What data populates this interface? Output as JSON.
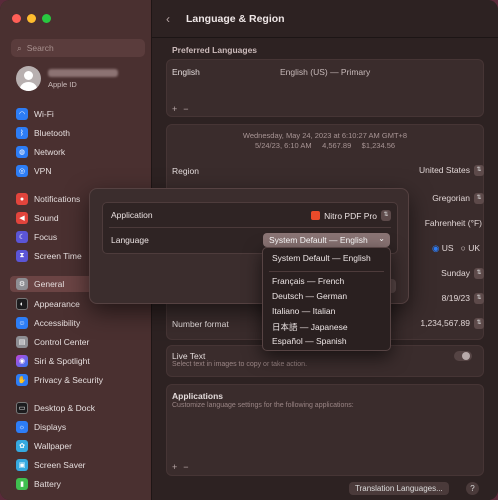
{
  "window": {
    "title": "Language & Region"
  },
  "traffic_lights": {
    "close": "#ff5f57",
    "minimize": "#febc2e",
    "zoom": "#28c840"
  },
  "sidebar": {
    "search_placeholder": "Search",
    "profile_sub": "Apple ID",
    "items": [
      {
        "label": "Wi-Fi",
        "icon": "wifi-icon",
        "color": "#2d7df6"
      },
      {
        "label": "Bluetooth",
        "icon": "bluetooth-icon",
        "color": "#2d7df6"
      },
      {
        "label": "Network",
        "icon": "globe-icon",
        "color": "#2d7df6"
      },
      {
        "label": "VPN",
        "icon": "vpn-icon",
        "color": "#2d7df6"
      },
      {
        "label": "Notifications",
        "icon": "bell-icon",
        "color": "#e2443c"
      },
      {
        "label": "Sound",
        "icon": "speaker-icon",
        "color": "#e2443c"
      },
      {
        "label": "Focus",
        "icon": "moon-icon",
        "color": "#5b55d6"
      },
      {
        "label": "Screen Time",
        "icon": "hourglass-icon",
        "color": "#5b55d6"
      },
      {
        "label": "General",
        "icon": "gear-icon",
        "color": "#8e8e93"
      },
      {
        "label": "Appearance",
        "icon": "appearance-icon",
        "color": "#1c1c1e"
      },
      {
        "label": "Accessibility",
        "icon": "accessibility-icon",
        "color": "#2d7df6"
      },
      {
        "label": "Control Center",
        "icon": "control-center-icon",
        "color": "#8e8e93"
      },
      {
        "label": "Siri & Spotlight",
        "icon": "siri-icon",
        "color": "#c543d8"
      },
      {
        "label": "Privacy & Security",
        "icon": "hand-icon",
        "color": "#2d7df6"
      },
      {
        "label": "Desktop & Dock",
        "icon": "dock-icon",
        "color": "#1c1c1e"
      },
      {
        "label": "Displays",
        "icon": "display-icon",
        "color": "#2d7df6"
      },
      {
        "label": "Wallpaper",
        "icon": "wallpaper-icon",
        "color": "#35a9e0"
      },
      {
        "label": "Screen Saver",
        "icon": "screensaver-icon",
        "color": "#35a9e0"
      },
      {
        "label": "Battery",
        "icon": "battery-icon",
        "color": "#3fbf4f"
      }
    ]
  },
  "main": {
    "preferred_languages_title": "Preferred Languages",
    "pref_lang_name": "English",
    "pref_lang_detail": "English (US) — Primary",
    "preview_line1": "Wednesday, May 24, 2023 at 6:10:27 AM GMT+8",
    "preview_line2": "5/24/23, 6:10 AM     4,567.89     $1,234.56",
    "region_label": "Region",
    "region_value": "United States",
    "calendar_value": "Gregorian",
    "temperature_value": "Fahrenheit (°F)",
    "measurement_us": "US",
    "measurement_uk": "UK",
    "first_day_value": "Sunday",
    "date_format_value": "8/19/23",
    "number_format_label": "Number format",
    "number_format_value": "1,234,567.89",
    "live_text_title": "Live Text",
    "live_text_hint": "Select text in images to copy or take action.",
    "applications_title": "Applications",
    "applications_hint": "Customize language settings for the following applications:",
    "translation_button": "Translation Languages...",
    "help_button": "?"
  },
  "sheet": {
    "application_label": "Application",
    "application_value": "Nitro PDF Pro",
    "language_label": "Language",
    "language_value": "System Default — English"
  },
  "menu": {
    "items": [
      "System Default — English",
      "Français — French",
      "Deutsch — German",
      "Italiano — Italian",
      "日本語 — Japanese",
      "Español — Spanish"
    ]
  }
}
